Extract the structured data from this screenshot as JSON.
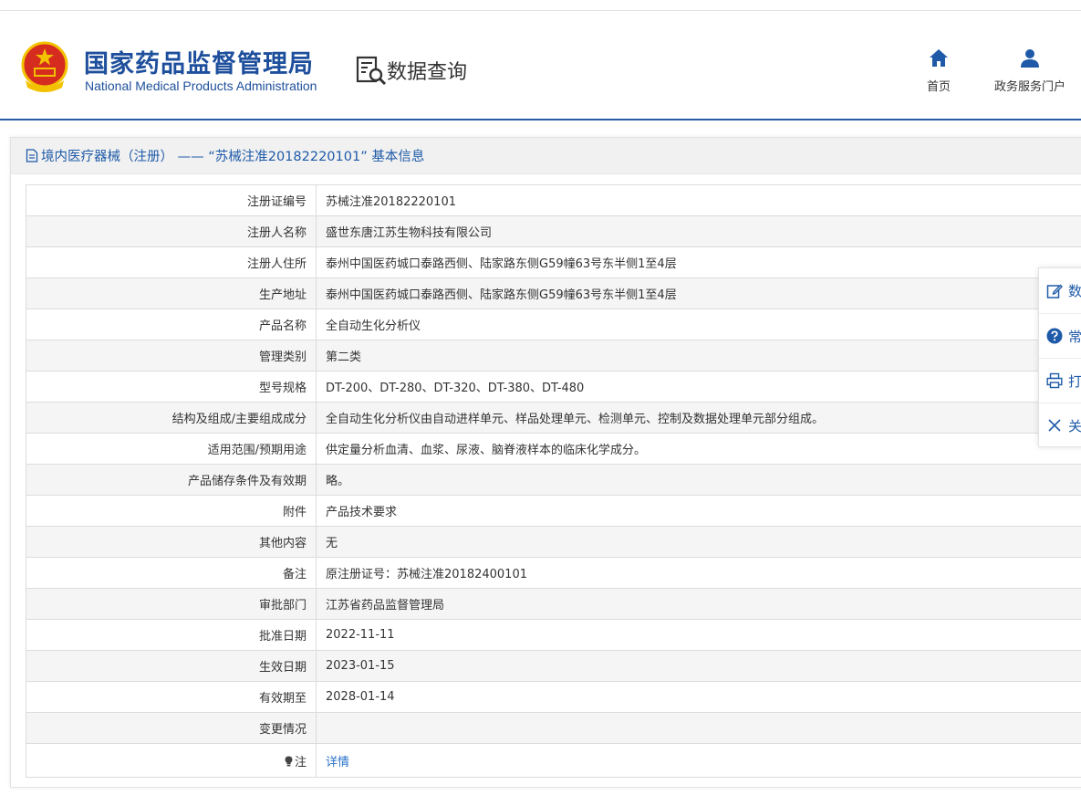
{
  "header": {
    "org_name_cn": "国家药品监督管理局",
    "org_name_en": "National Medical Products Administration",
    "section_title": "数据查询",
    "nav": [
      {
        "label": "首页",
        "icon": "home-icon"
      },
      {
        "label": "政务服务门户",
        "icon": "user-icon"
      }
    ]
  },
  "panel": {
    "title": "境内医疗器械（注册） —— “苏械注准20182220101” 基本信息",
    "rows": [
      {
        "label": "注册证编号",
        "value": "苏械注准20182220101"
      },
      {
        "label": "注册人名称",
        "value": "盛世东唐江苏生物科技有限公司"
      },
      {
        "label": "注册人住所",
        "value": "泰州中国医药城口泰路西侧、陆家路东侧G59幢63号东半侧1至4层"
      },
      {
        "label": "生产地址",
        "value": "泰州中国医药城口泰路西侧、陆家路东侧G59幢63号东半侧1至4层"
      },
      {
        "label": "产品名称",
        "value": "全自动生化分析仪"
      },
      {
        "label": "管理类别",
        "value": "第二类"
      },
      {
        "label": "型号规格",
        "value": "DT-200、DT-280、DT-320、DT-380、DT-480"
      },
      {
        "label": "结构及组成/主要组成成分",
        "value": "全自动生化分析仪由自动进样单元、样品处理单元、检测单元、控制及数据处理单元部分组成。"
      },
      {
        "label": "适用范围/预期用途",
        "value": "供定量分析血清、血浆、尿液、脑脊液样本的临床化学成分。"
      },
      {
        "label": "产品储存条件及有效期",
        "value": "略。"
      },
      {
        "label": "附件",
        "value": "产品技术要求"
      },
      {
        "label": "其他内容",
        "value": "无"
      },
      {
        "label": "备注",
        "value": "原注册证号：苏械注准20182400101"
      },
      {
        "label": "审批部门",
        "value": "江苏省药品监督管理局"
      },
      {
        "label": "批准日期",
        "value": "2022-11-11"
      },
      {
        "label": "生效日期",
        "value": "2023-01-15"
      },
      {
        "label": "有效期至",
        "value": "2028-01-14"
      },
      {
        "label": "变更情况",
        "value": ""
      }
    ],
    "note_row": {
      "label": "注",
      "icon": "lightbulb-icon",
      "link_text": "详情"
    }
  },
  "floating_toolbar": [
    {
      "label": "数",
      "icon": "edit-icon"
    },
    {
      "label": "常",
      "icon": "question-icon"
    },
    {
      "label": "打",
      "icon": "print-icon"
    },
    {
      "label": "关",
      "icon": "close-icon"
    }
  ],
  "colors": {
    "brand_blue": "#1e4f9c",
    "link_blue": "#2a72c9",
    "row_alt": "#f5f5f5",
    "emblem_red": "#d62b1f",
    "emblem_gold": "#f2c200"
  }
}
